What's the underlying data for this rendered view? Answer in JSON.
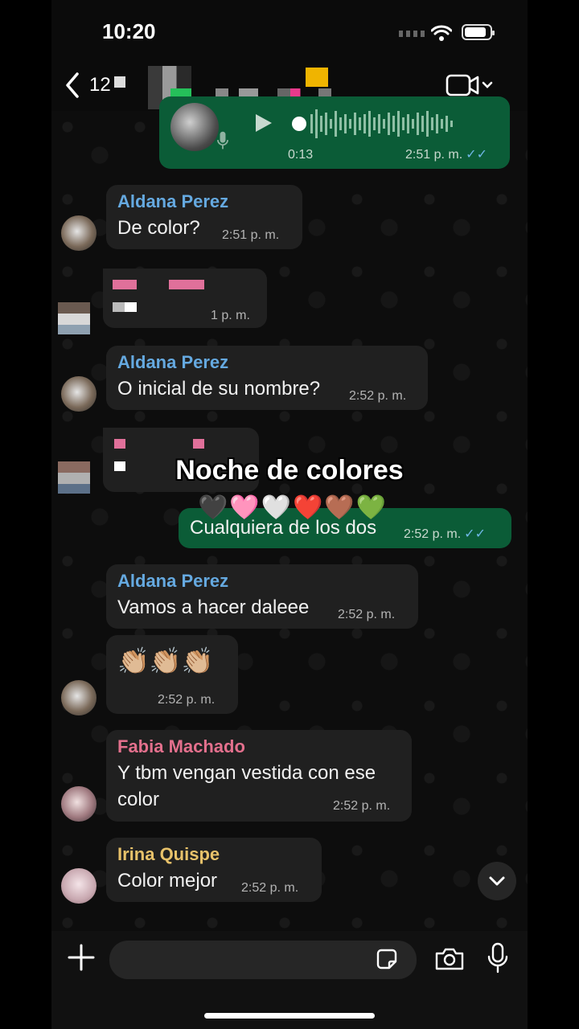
{
  "status_bar": {
    "time": "10:20"
  },
  "header": {
    "back_count": "12"
  },
  "voice_message": {
    "duration": "0:13",
    "time": "2:51 p. m.",
    "ticks": "✓✓"
  },
  "messages": [
    {
      "sender": "Aldana Perez",
      "text": "De color?",
      "time": "2:51 p. m."
    },
    {
      "sender": "",
      "text": "",
      "time": "1 p. m."
    },
    {
      "sender": "Aldana Perez",
      "text": "O inicial de su nombre?",
      "time": "2:52 p. m."
    },
    {
      "sender": "",
      "text": "Cualquiera de los dos",
      "time": "2:52 p. m.",
      "ticks": "✓✓"
    },
    {
      "sender": "Aldana Perez",
      "text": "Vamos a hacer daleee",
      "time": "2:52 p. m."
    },
    {
      "sender": "",
      "text": "👏🏼👏🏼👏🏼",
      "time": "2:52 p. m."
    },
    {
      "sender": "Fabia Machado",
      "text": "Y tbm vengan vestida con ese color",
      "time": "2:52 p. m."
    },
    {
      "sender": "Irina Quispe",
      "text": "Color mejor",
      "time": "2:52 p. m."
    }
  ],
  "overlay": {
    "caption": "Noche de colores",
    "hearts": "🖤🩷🤍❤️🤎💚"
  },
  "colors": {
    "aldana": "#65a9e0",
    "fabia": "#e4708d",
    "irina": "#e8c26a",
    "outgoing": "#0b5c37",
    "incoming": "#202020"
  },
  "icons": [
    "back-chevron-icon",
    "video-call-icon",
    "play-icon",
    "mic-icon",
    "plus-icon",
    "sticker-icon",
    "camera-icon",
    "chevron-down-icon"
  ]
}
